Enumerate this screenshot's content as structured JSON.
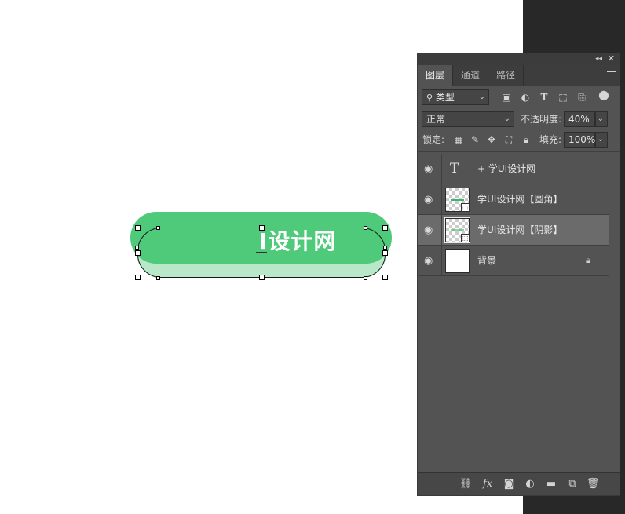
{
  "canvas": {
    "button_text": "I设计网",
    "colors": {
      "pill_main": "#4fc97a",
      "pill_shadow": "#b9e8c8"
    }
  },
  "panel": {
    "tabs": [
      {
        "label": "图层",
        "active": true
      },
      {
        "label": "通道",
        "active": false
      },
      {
        "label": "路径",
        "active": false
      }
    ],
    "filter": {
      "label": "类型",
      "icons": [
        "image-icon",
        "adjustment-icon",
        "text-filter-icon",
        "shape-filter-icon",
        "smart-object-icon",
        "filter-toggle-icon"
      ]
    },
    "blend": {
      "mode": "正常",
      "opacity_label": "不透明度:",
      "opacity_value": "40%"
    },
    "lock": {
      "label": "锁定:",
      "fill_label": "填充:",
      "fill_value": "100%"
    },
    "layers": [
      {
        "name": "+ 学UI设计网",
        "kind": "text",
        "selected": false
      },
      {
        "name": "学UI设计网【圆角】",
        "kind": "shape",
        "selected": false
      },
      {
        "name": "学UI设计网【阴影】",
        "kind": "shape",
        "selected": true
      },
      {
        "name": "背景",
        "kind": "background",
        "selected": false,
        "locked": true
      }
    ],
    "bottom_icons": [
      "link-icon",
      "fx-icon",
      "mask-icon",
      "adjustment-layer-icon",
      "folder-icon",
      "new-layer-icon",
      "trash-icon"
    ]
  }
}
